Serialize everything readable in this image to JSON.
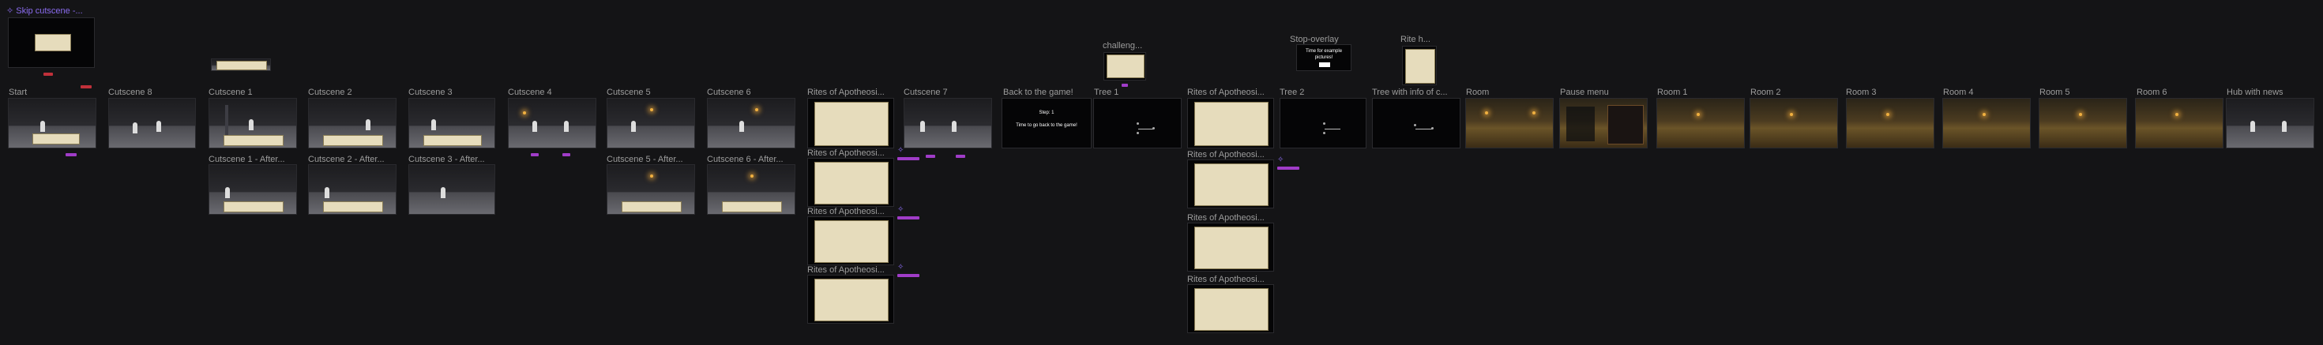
{
  "flow": {
    "skip": {
      "label": "Skip cutscene -..."
    },
    "start": {
      "label": "Start"
    },
    "cs8": {
      "label": "Cutscene 8"
    },
    "cs1": {
      "label": "Cutscene 1"
    },
    "cs1a": {
      "label": "Cutscene 1 - After..."
    },
    "cs2": {
      "label": "Cutscene 2"
    },
    "cs2a": {
      "label": "Cutscene 2 - After..."
    },
    "cs3": {
      "label": "Cutscene 3"
    },
    "cs3a": {
      "label": "Cutscene 3 - After..."
    },
    "cs4": {
      "label": "Cutscene 4"
    },
    "cs5": {
      "label": "Cutscene 5"
    },
    "cs5a": {
      "label": "Cutscene 5 - After..."
    },
    "cs6": {
      "label": "Cutscene 6"
    },
    "cs6a": {
      "label": "Cutscene 6 - After..."
    },
    "rites1": {
      "label": "Rites of Apotheosi..."
    },
    "rites2": {
      "label": "Rites of Apotheosi..."
    },
    "rites3": {
      "label": "Rites of Apotheosi..."
    },
    "rites4": {
      "label": "Rites of Apotheosi..."
    },
    "cs7": {
      "label": "Cutscene 7"
    },
    "back": {
      "label": "Back to the game!",
      "step": "Step: 1",
      "body": "Time to go back to the game!"
    },
    "challenge": {
      "label": "challeng..."
    },
    "tree1": {
      "label": "Tree 1"
    },
    "riteb1": {
      "label": "Rites of Apotheosi..."
    },
    "riteb2": {
      "label": "Rites of Apotheosi..."
    },
    "riteb3": {
      "label": "Rites of Apotheosi..."
    },
    "riteb4": {
      "label": "Rites of Apotheosi..."
    },
    "stop": {
      "label": "Stop-overlay",
      "body": "Time for example pictures!"
    },
    "tree2": {
      "label": "Tree 2"
    },
    "riteh": {
      "label": "Rite h..."
    },
    "treeinfo": {
      "label": "Tree with info of c..."
    },
    "room": {
      "label": "Room"
    },
    "pause": {
      "label": "Pause menu"
    },
    "room1": {
      "label": "Room 1"
    },
    "room2": {
      "label": "Room 2"
    },
    "room3": {
      "label": "Room 3"
    },
    "room4": {
      "label": "Room 4"
    },
    "room5": {
      "label": "Room 5"
    },
    "room6": {
      "label": "Room 6"
    },
    "hub": {
      "label": "Hub with news"
    }
  },
  "colors": {
    "canvas": "#141416",
    "accent": "#8b6cf0",
    "connector": "#a03cc8",
    "parchment": "#e6dcbc"
  }
}
